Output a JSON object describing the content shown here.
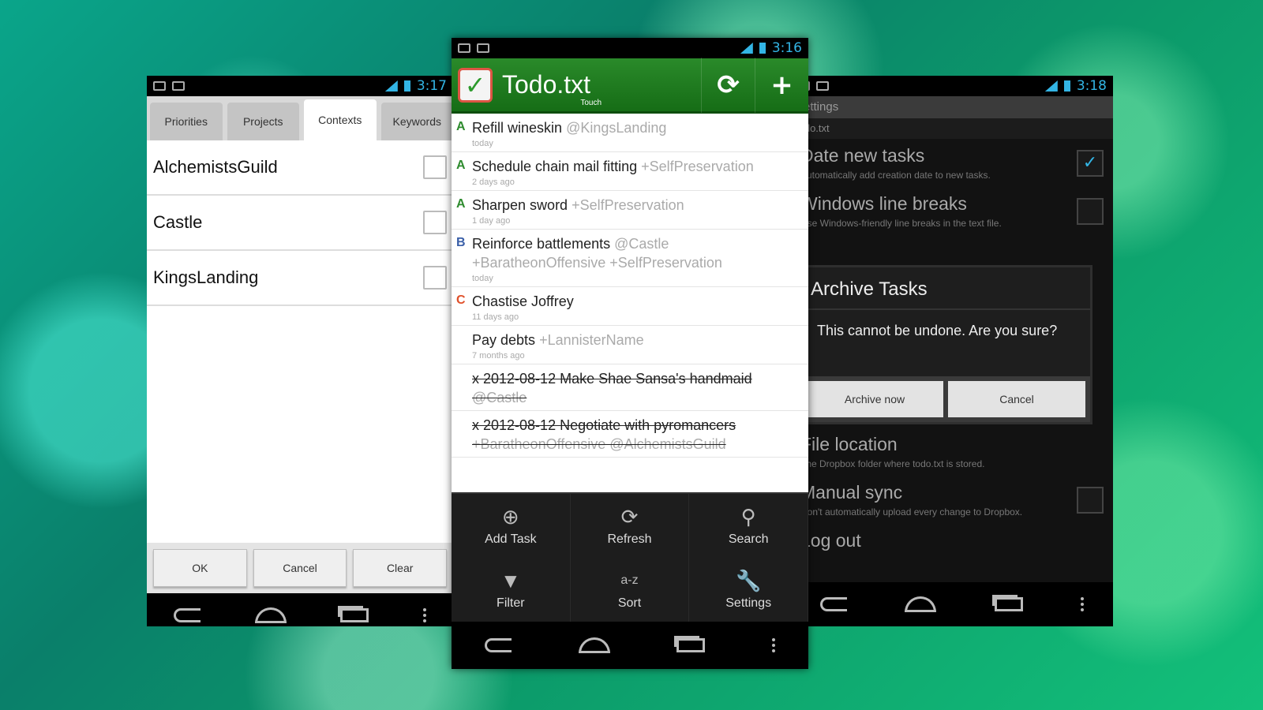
{
  "left_phone": {
    "status_time": "3:17",
    "tabs": [
      "Priorities",
      "Projects",
      "Contexts",
      "Keywords"
    ],
    "contexts": [
      "AlchemistsGuild",
      "Castle",
      "KingsLanding"
    ],
    "buttons": [
      "OK",
      "Cancel",
      "Clear"
    ]
  },
  "center_phone": {
    "status_time": "3:16",
    "app_title": "Todo.txt",
    "app_subtitle": "Touch",
    "tasks": [
      {
        "priority": "A",
        "priority_color": "#2e8b2e",
        "text": "Refill wineskin",
        "tags": "@KingsLanding",
        "age": "today"
      },
      {
        "priority": "A",
        "priority_color": "#2e8b2e",
        "text": "Schedule chain mail fitting",
        "tags": "+SelfPreservation",
        "age": "2 days ago"
      },
      {
        "priority": "A",
        "priority_color": "#2e8b2e",
        "text": "Sharpen sword",
        "tags": "+SelfPreservation",
        "age": "1 day ago"
      },
      {
        "priority": "B",
        "priority_color": "#3a5fa8",
        "text": "Reinforce battlements",
        "tags": "@Castle +BaratheonOffensive +SelfPreservation",
        "age": "today"
      },
      {
        "priority": "C",
        "priority_color": "#e0502a",
        "text": "Chastise Joffrey",
        "tags": "",
        "age": "11 days ago"
      },
      {
        "priority": "",
        "priority_color": "#000000",
        "text": "Pay debts",
        "tags": "+LannisterName",
        "age": "7 months ago"
      },
      {
        "priority": "",
        "priority_color": "#000000",
        "text": "x 2012-08-12 Make Shae Sansa's handmaid",
        "tags": "@Castle",
        "age": ""
      },
      {
        "priority": "",
        "priority_color": "#000000",
        "text": "x 2012-08-12 Negotiate with pyromancers",
        "tags": "+BaratheonOffensive @AlchemistsGuild",
        "age": ""
      }
    ],
    "menu": [
      {
        "label": "Add Task",
        "icon": "add-circle-icon"
      },
      {
        "label": "Refresh",
        "icon": "refresh-icon"
      },
      {
        "label": "Search",
        "icon": "search-icon"
      },
      {
        "label": "Filter",
        "icon": "filter-icon"
      },
      {
        "label": "Sort",
        "icon": "sort-az-icon",
        "glyph": "a-z"
      },
      {
        "label": "Settings",
        "icon": "wrench-icon"
      }
    ]
  },
  "right_phone": {
    "status_time": "3:18",
    "header": "Settings",
    "subheader": "todo.txt",
    "settings": [
      {
        "title": "Date new tasks",
        "desc": "Automatically add creation date to new tasks.",
        "checked": true
      },
      {
        "title": "Windows line breaks",
        "desc": "Use Windows-friendly line breaks in the text file.",
        "checked": false
      }
    ],
    "dialog": {
      "title": "Archive Tasks",
      "message": "This cannot be undone. Are you sure?",
      "confirm": "Archive now",
      "cancel": "Cancel"
    },
    "lower_settings": [
      {
        "title": "File location",
        "desc": "The Dropbox folder where todo.txt is stored.",
        "has_check": false
      },
      {
        "title": "Manual sync",
        "desc": "Don't automatically upload every change to Dropbox.",
        "has_check": true
      },
      {
        "title": "Log out",
        "desc": "",
        "has_check": false
      }
    ]
  },
  "colors": {
    "accent_blue": "#33b5e5",
    "app_green": "#1f7f1f",
    "priority_a": "#2e8b2e",
    "priority_b": "#3a5fa8",
    "priority_c": "#e0502a"
  }
}
